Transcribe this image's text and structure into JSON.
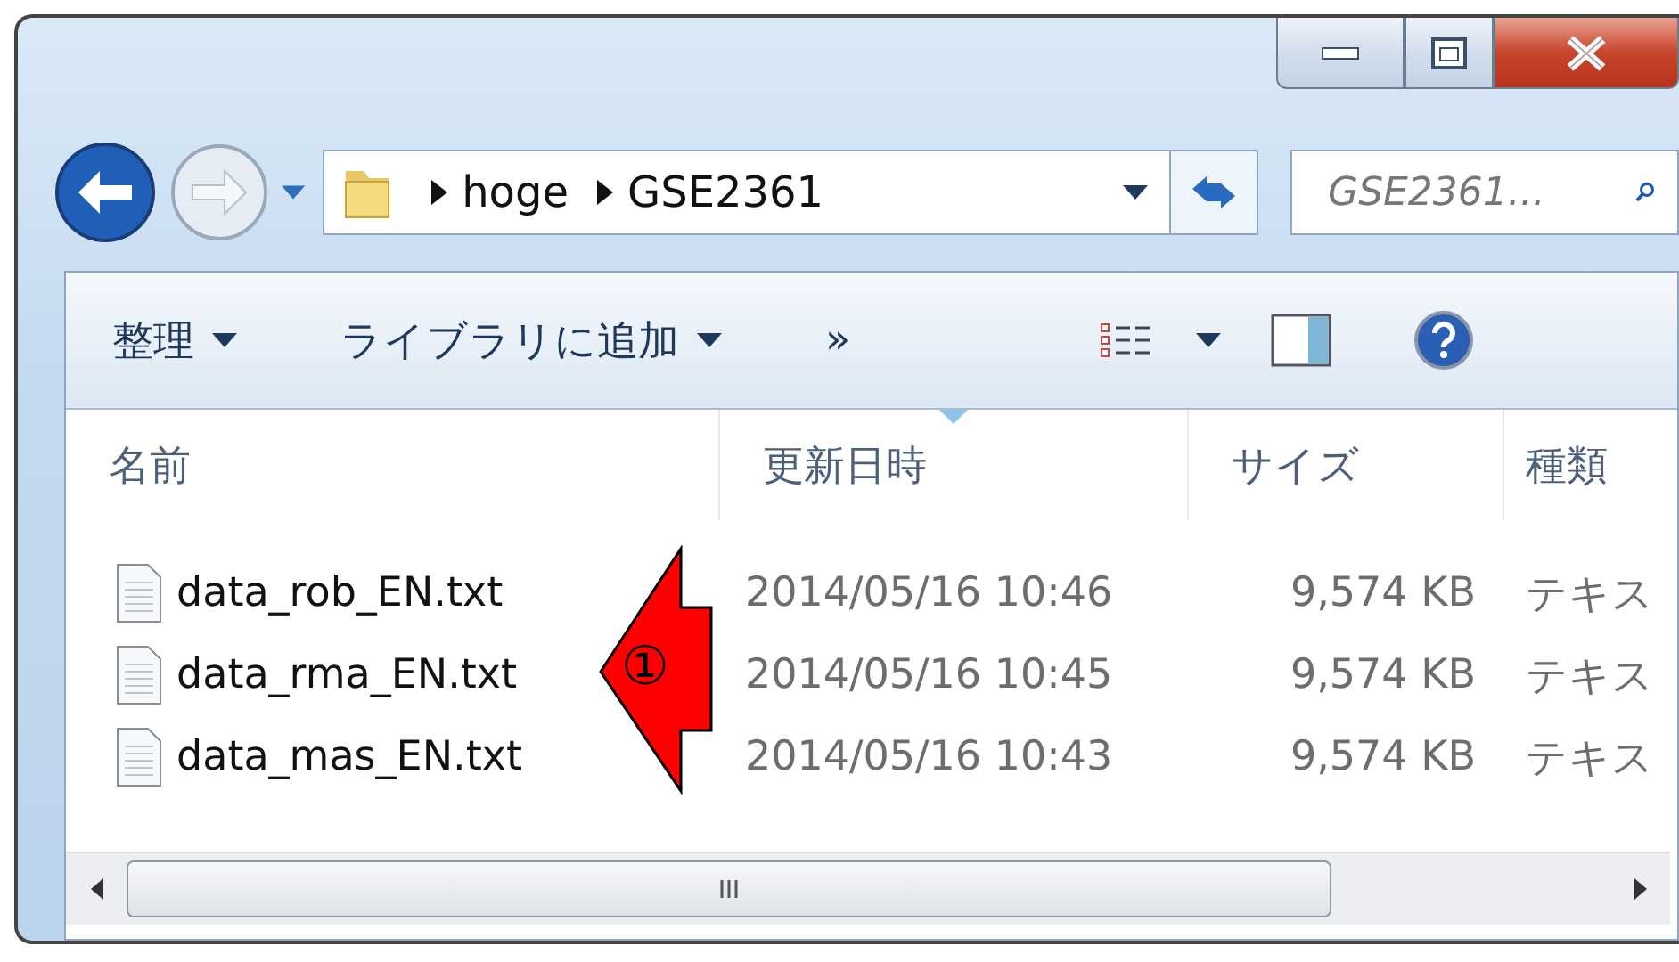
{
  "address_bar": {
    "breadcrumbs": [
      "hoge",
      "GSE2361"
    ]
  },
  "search": {
    "placeholder": "GSE2361..."
  },
  "toolbar": {
    "items": [
      {
        "label": "整理",
        "kind": "menu"
      },
      {
        "label": "ライブラリに追加",
        "kind": "menu"
      },
      {
        "label": "»",
        "kind": "more"
      }
    ]
  },
  "columns": [
    {
      "label": "名前",
      "sorted": false
    },
    {
      "label": "更新日時",
      "sorted": true
    },
    {
      "label": "サイズ",
      "sorted": false
    },
    {
      "label": "種類",
      "sorted": false
    }
  ],
  "rows": [
    {
      "name": "data_rob_EN.txt",
      "modified": "2014/05/16 10:46",
      "size": "9,574 KB",
      "type": "テキス"
    },
    {
      "name": "data_rma_EN.txt",
      "modified": "2014/05/16 10:45",
      "size": "9,574 KB",
      "type": "テキス"
    },
    {
      "name": "data_mas_EN.txt",
      "modified": "2014/05/16 10:43",
      "size": "9,574 KB",
      "type": "テキス"
    }
  ],
  "annotation": {
    "label": "①"
  }
}
